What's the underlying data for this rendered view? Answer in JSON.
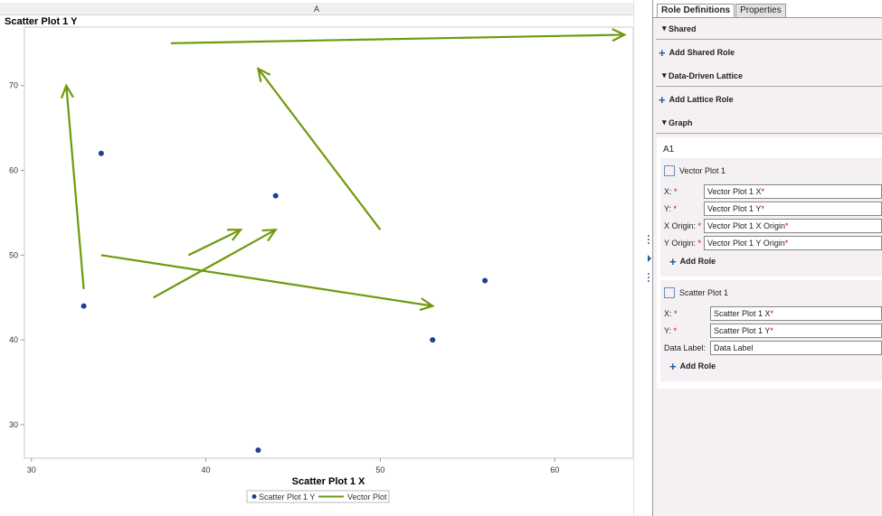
{
  "header": {
    "cell_label": "A"
  },
  "chart_data": {
    "type": "scatter",
    "title": "",
    "ylabel": "Scatter Plot 1 Y",
    "xlabel": "Scatter Plot 1 X",
    "xlim": [
      29.6,
      64.5
    ],
    "ylim": [
      26.05,
      76.9
    ],
    "xticks": [
      30,
      40,
      50,
      60
    ],
    "yticks": [
      30,
      40,
      50,
      60,
      70
    ],
    "grid": false,
    "scatter": {
      "name": "Scatter Plot 1 Y",
      "color": "#1f3f93",
      "points": [
        [
          33,
          44
        ],
        [
          34,
          62
        ],
        [
          44,
          57
        ],
        [
          43,
          27
        ],
        [
          53,
          40
        ],
        [
          56,
          47
        ]
      ]
    },
    "vectors": {
      "name": "Vector Plot",
      "color": "#6e9a0f",
      "segments": [
        {
          "x0": 33,
          "y0": 46,
          "x": 32,
          "y": 70
        },
        {
          "x0": 34,
          "y0": 50,
          "x": 53,
          "y": 44
        },
        {
          "x0": 37,
          "y0": 45,
          "x": 44,
          "y": 53
        },
        {
          "x0": 39,
          "y0": 50,
          "x": 42,
          "y": 53
        },
        {
          "x0": 50,
          "y0": 53,
          "x": 43,
          "y": 72
        },
        {
          "x0": 38,
          "y0": 75,
          "x": 64,
          "y": 76
        }
      ]
    },
    "legend": {
      "placement": "bottom",
      "entries": [
        "Scatter Plot 1 Y",
        "Vector Plot"
      ]
    }
  },
  "panel": {
    "tabs": [
      "Role Definitions",
      "Properties"
    ],
    "shared": "Shared",
    "add_shared": "Add Shared Role",
    "lattice": "Data-Driven Lattice",
    "add_lattice": "Add Lattice Role",
    "graph": "Graph",
    "cell": "A1",
    "vector": {
      "name": "Vector Plot 1",
      "add": "Add Role",
      "roles": [
        {
          "label": "X:",
          "value": "Vector Plot 1 X"
        },
        {
          "label": "Y:",
          "value": "Vector Plot 1 Y"
        },
        {
          "label": "X Origin:",
          "value": "Vector Plot 1 X Origin"
        },
        {
          "label": "Y Origin:",
          "value": "Vector Plot 1 Y Origin"
        }
      ]
    },
    "scatter": {
      "name": "Scatter Plot 1",
      "add": "Add Role",
      "roles": [
        {
          "label": "X:",
          "value": "Scatter Plot 1 X"
        },
        {
          "label": "Y:",
          "value": "Scatter Plot 1 Y"
        },
        {
          "label": "Data Label:",
          "value": "Data Label"
        }
      ]
    },
    "required_mark": "*"
  }
}
